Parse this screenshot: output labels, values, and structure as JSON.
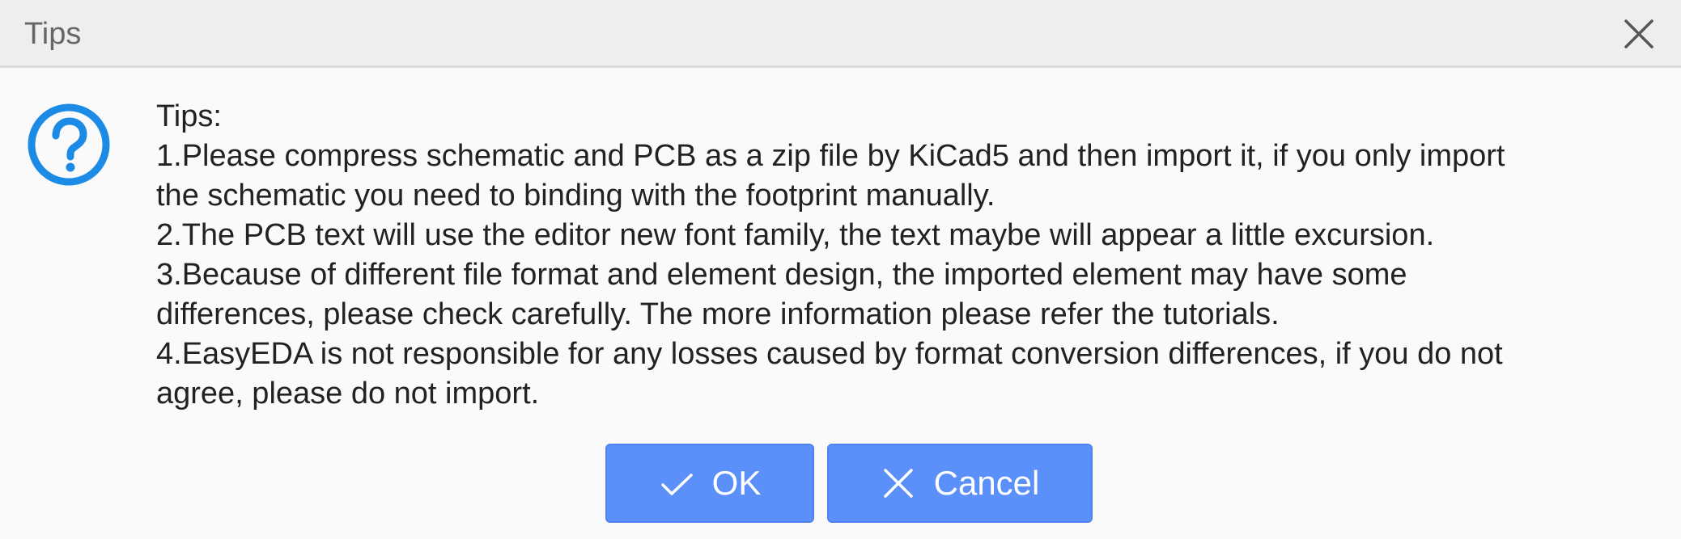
{
  "dialog": {
    "title": "Tips",
    "close_icon": "close-icon",
    "help_icon": "question-circle-icon",
    "help_icon_color": "#1b8be6",
    "message_lines": [
      "Tips:",
      "1.Please compress schematic and PCB as a zip file by KiCad5 and then import it, if you only import",
      "the schematic you need to binding with the footprint manually.",
      "2.The PCB text will use the editor new font family, the text maybe will appear a little excursion.",
      "3.Because of different file format and element design, the imported element may have some",
      "differences, please check carefully. The more information please refer the tutorials.",
      "4.EasyEDA is not responsible for any losses caused by format conversion differences, if you do not",
      "agree, please do not import."
    ],
    "buttons": {
      "ok_label": "OK",
      "ok_icon": "check-icon",
      "cancel_label": "Cancel",
      "cancel_icon": "close-icon"
    },
    "button_color": "#5b8ff9"
  }
}
